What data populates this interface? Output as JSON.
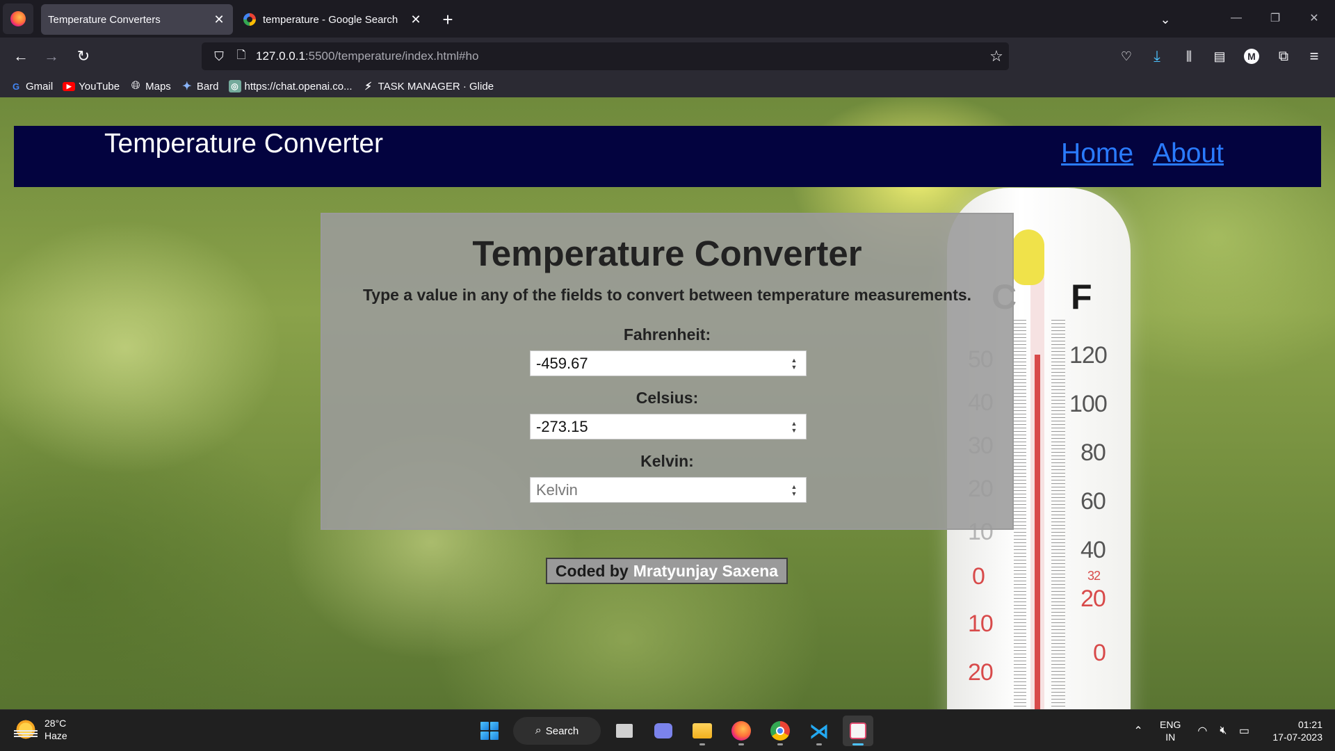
{
  "browser": {
    "tabs": [
      {
        "title": "Temperature Converters",
        "active": true
      },
      {
        "title": "temperature - Google Search",
        "active": false
      }
    ],
    "url": {
      "host": "127.0.0.1",
      "rest": ":5500/temperature/index.html#ho"
    },
    "bookmarks": [
      {
        "label": "Gmail",
        "icon": "google-icon"
      },
      {
        "label": "YouTube",
        "icon": "youtube-icon"
      },
      {
        "label": "Maps",
        "icon": "globe-icon"
      },
      {
        "label": "Bard",
        "icon": "sparkle-icon"
      },
      {
        "label": "https://chat.openai.co...",
        "icon": "openai-icon"
      },
      {
        "label": "TASK MANAGER · Glide",
        "icon": "glide-icon"
      }
    ],
    "profile_initial": "M"
  },
  "site": {
    "brand": "Temperature Converter",
    "nav": [
      {
        "label": "Home"
      },
      {
        "label": "About"
      }
    ]
  },
  "converter": {
    "title": "Temperature Converter",
    "subtitle": "Type a value in any of the fields to convert between temperature measurements.",
    "fields": [
      {
        "label": "Fahrenheit:",
        "value": "-459.67",
        "placeholder": "Fahrenheit"
      },
      {
        "label": "Celsius:",
        "value": "-273.15",
        "placeholder": "Celsius"
      },
      {
        "label": "Kelvin:",
        "value": "",
        "placeholder": "Kelvin"
      }
    ]
  },
  "credit": {
    "prefix": "Coded by",
    "name": "Mratyunjay Saxena"
  },
  "thermometer": {
    "unit_c": "C",
    "unit_f": "F",
    "celsius_marks": [
      "50",
      "40",
      "30",
      "20",
      "10",
      "0",
      "10",
      "20"
    ],
    "fahrenheit_marks": [
      "120",
      "100",
      "80",
      "60",
      "40",
      "32",
      "20",
      "0"
    ]
  },
  "taskbar": {
    "weather": {
      "temp": "28°C",
      "condition": "Haze"
    },
    "search_label": "Search",
    "language": {
      "line1": "ENG",
      "line2": "IN"
    },
    "time": "01:21",
    "date": "17-07-2023"
  },
  "colors": {
    "header_bg": "#03033f",
    "nav_link": "#2a7bff",
    "panel_bg": "#9b9b9b",
    "accent_blue": "#4cc2ff"
  }
}
